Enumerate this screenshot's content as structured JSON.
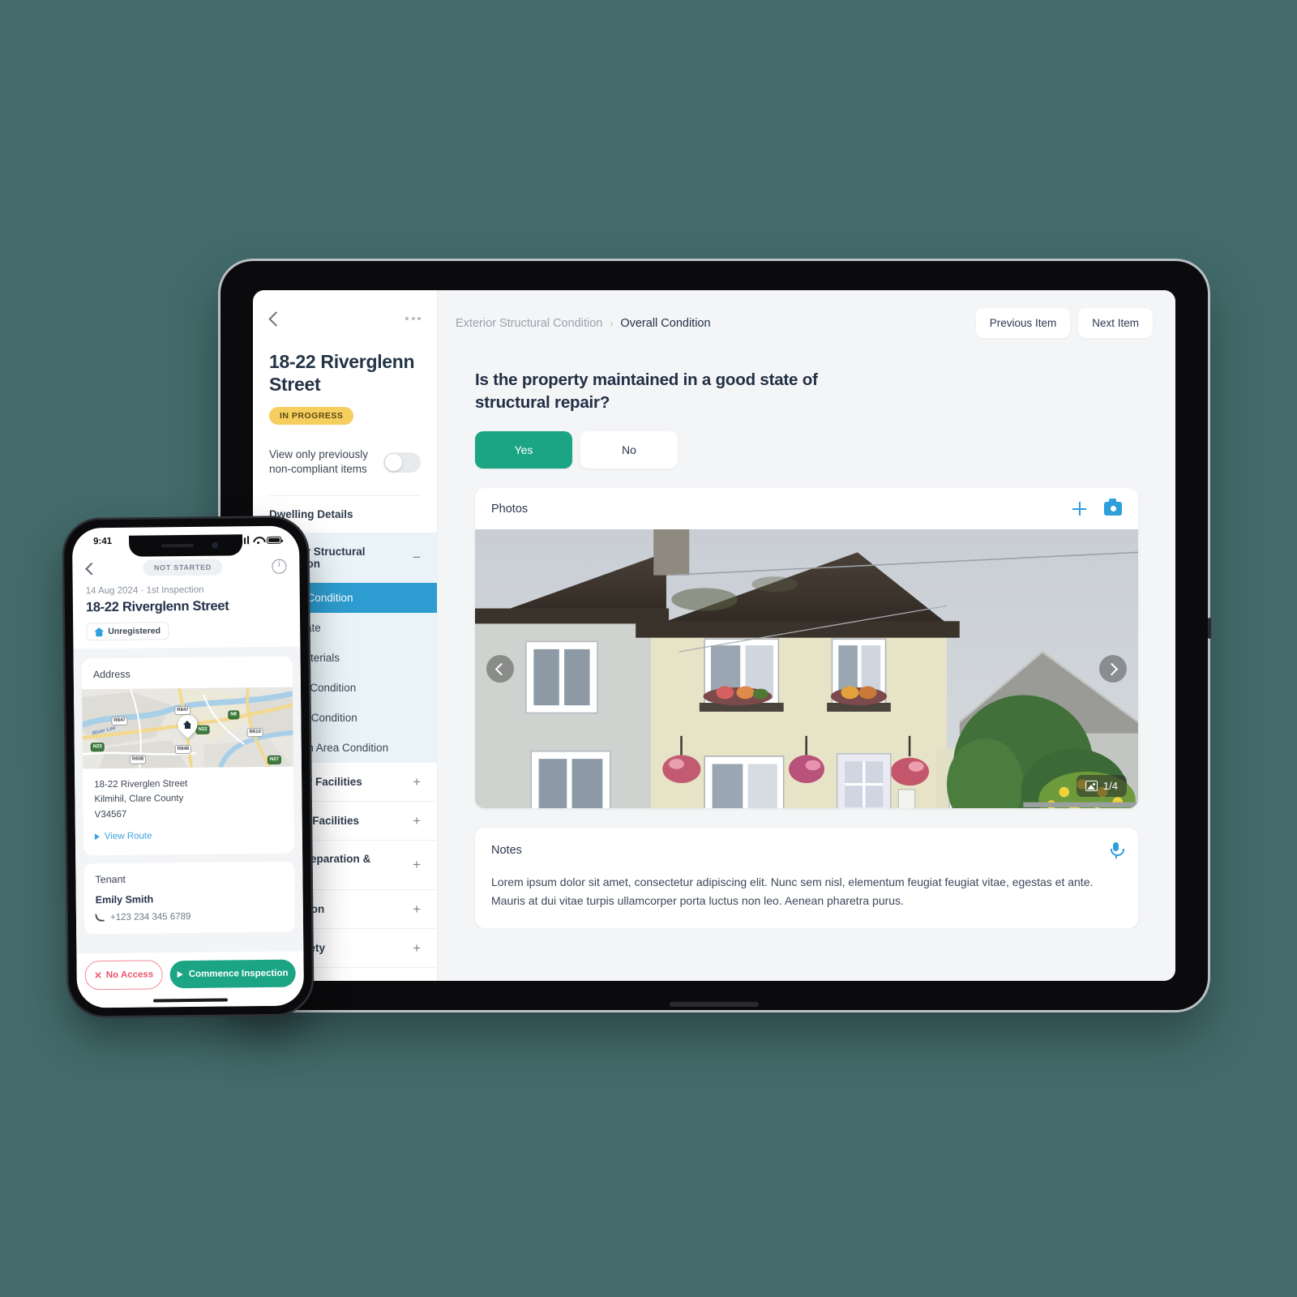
{
  "tablet": {
    "panel": {
      "back_icon": "chevron-left-icon",
      "more_icon": "more-options-icon",
      "property_title": "18-22 Riverglenn Street",
      "status_badge": "IN PROGRESS",
      "toggle_label": "View only previously non-compliant items",
      "toggle_on": false,
      "groups": [
        {
          "label": "Dwelling Details",
          "expanded": false,
          "sign": ""
        },
        {
          "label": "Exterior Structural Condition",
          "expanded": true,
          "sign": "−",
          "items": [
            {
              "label": "Overall Condition",
              "active": true
            },
            {
              "label": "Roof State",
              "active": false
            },
            {
              "label": "Roof Materials",
              "active": false
            },
            {
              "label": "Surface Condition",
              "active": false
            },
            {
              "label": "Window Condition",
              "active": false
            },
            {
              "label": "Common Area Condition",
              "active": false
            }
          ]
        },
        {
          "label": "Sanitary Facilities",
          "expanded": false,
          "sign": "+"
        },
        {
          "label": "Heating Facilities",
          "expanded": false,
          "sign": "+"
        },
        {
          "label": "Food Preparation & Storage",
          "expanded": false,
          "sign": "+"
        },
        {
          "label": "Ventilation",
          "expanded": false,
          "sign": "+"
        },
        {
          "label": "Fire Safety",
          "expanded": false,
          "sign": "+"
        }
      ]
    },
    "header": {
      "breadcrumb_parent": "Exterior Structural Condition",
      "breadcrumb_separator": "›",
      "breadcrumb_current": "Overall Condition",
      "previous_button": "Previous Item",
      "next_button": "Next Item"
    },
    "question": {
      "text": "Is the property maintained in a good state of structural repair?",
      "answers": [
        {
          "label": "Yes",
          "selected": true
        },
        {
          "label": "No",
          "selected": false
        }
      ]
    },
    "photos": {
      "title": "Photos",
      "add_icon": "plus-icon",
      "camera_icon": "camera-icon",
      "prev_icon": "chevron-left-icon",
      "next_icon": "chevron-right-icon",
      "counter": "1/4",
      "counter_icon": "image-icon"
    },
    "notes": {
      "title": "Notes",
      "mic_icon": "microphone-icon",
      "body": "Lorem ipsum dolor sit amet, consectetur adipiscing elit. Nunc sem nisl, elementum feugiat feugiat vitae, egestas et ante. Mauris at dui vitae turpis ullamcorper porta luctus non leo. Aenean pharetra purus."
    }
  },
  "phone": {
    "status": {
      "time": "9:41",
      "signal_icon": "cellular-icon",
      "wifi_icon": "wifi-icon",
      "battery_icon": "battery-icon"
    },
    "header": {
      "back_icon": "chevron-left-icon",
      "status_badge": "NOT STARTED",
      "info_icon": "info-icon"
    },
    "meta": "14 Aug 2024  ·  1st Inspection",
    "title": "18-22 Riverglenn Street",
    "registration_chip": {
      "label": "Unregistered",
      "icon": "house-icon"
    },
    "address_card": {
      "title": "Address",
      "line1": "18-22 Riverglen Street",
      "line2": "Kilmihil, Clare County",
      "line3": "V34567",
      "route_link": "View Route",
      "route_icon": "play-triangle-icon",
      "map_pin_icon": "home-pin-icon",
      "map_labels": [
        "R847",
        "R847",
        "N8",
        "N22",
        "R610",
        "N23",
        "R848",
        "R608",
        "N27"
      ],
      "map_river_label": "River Lee"
    },
    "tenant_card": {
      "title": "Tenant",
      "name": "Emily Smith",
      "phone": "+123 234 345 6789",
      "phone_icon": "phone-icon"
    },
    "actions": {
      "no_access": "No Access",
      "no_access_icon": "close-x-icon",
      "commence": "Commence Inspection",
      "commence_icon": "play-triangle-icon"
    }
  },
  "colors": {
    "background": "#436b6b",
    "accent_teal": "#1ba584",
    "accent_blue": "#2d9cd0",
    "icon_blue": "#2f9fdc",
    "badge_yellow": "#f5ce5e",
    "danger_red": "#e8596f",
    "text_dark": "#23314a"
  }
}
